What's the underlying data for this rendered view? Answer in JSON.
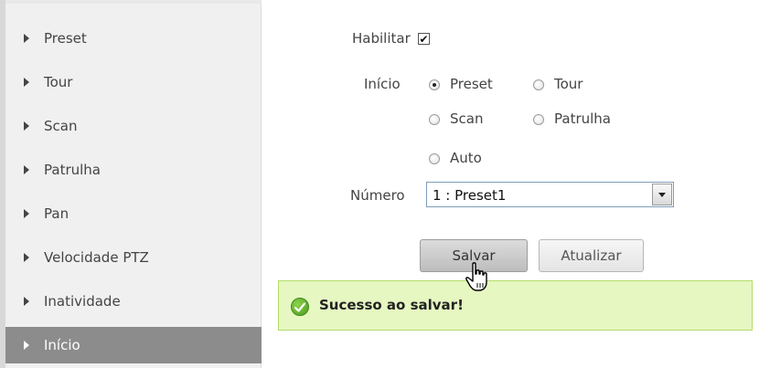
{
  "sidebar": {
    "items": [
      {
        "label": "Preset"
      },
      {
        "label": "Tour"
      },
      {
        "label": "Scan"
      },
      {
        "label": "Patrulha"
      },
      {
        "label": "Pan"
      },
      {
        "label": "Velocidade PTZ"
      },
      {
        "label": "Inatividade"
      },
      {
        "label": "Início"
      }
    ],
    "active": "Início"
  },
  "form": {
    "enable_label": "Habilitar",
    "enable_checked": true,
    "start_label": "Início",
    "start_options": [
      "Preset",
      "Tour",
      "Scan",
      "Patrulha",
      "Auto"
    ],
    "start_selected": "Preset",
    "number_label": "Número",
    "number_value": "1 : Preset1"
  },
  "buttons": {
    "save_label": "Salvar",
    "refresh_label": "Atualizar"
  },
  "notification": {
    "message": "Sucesso ao salvar!",
    "type": "success",
    "icon": "check-circle-icon"
  },
  "colors": {
    "active_item_bg": "#8c8c8c",
    "success_bg": "#e6f7c1",
    "success_border": "#b2dc6a"
  }
}
